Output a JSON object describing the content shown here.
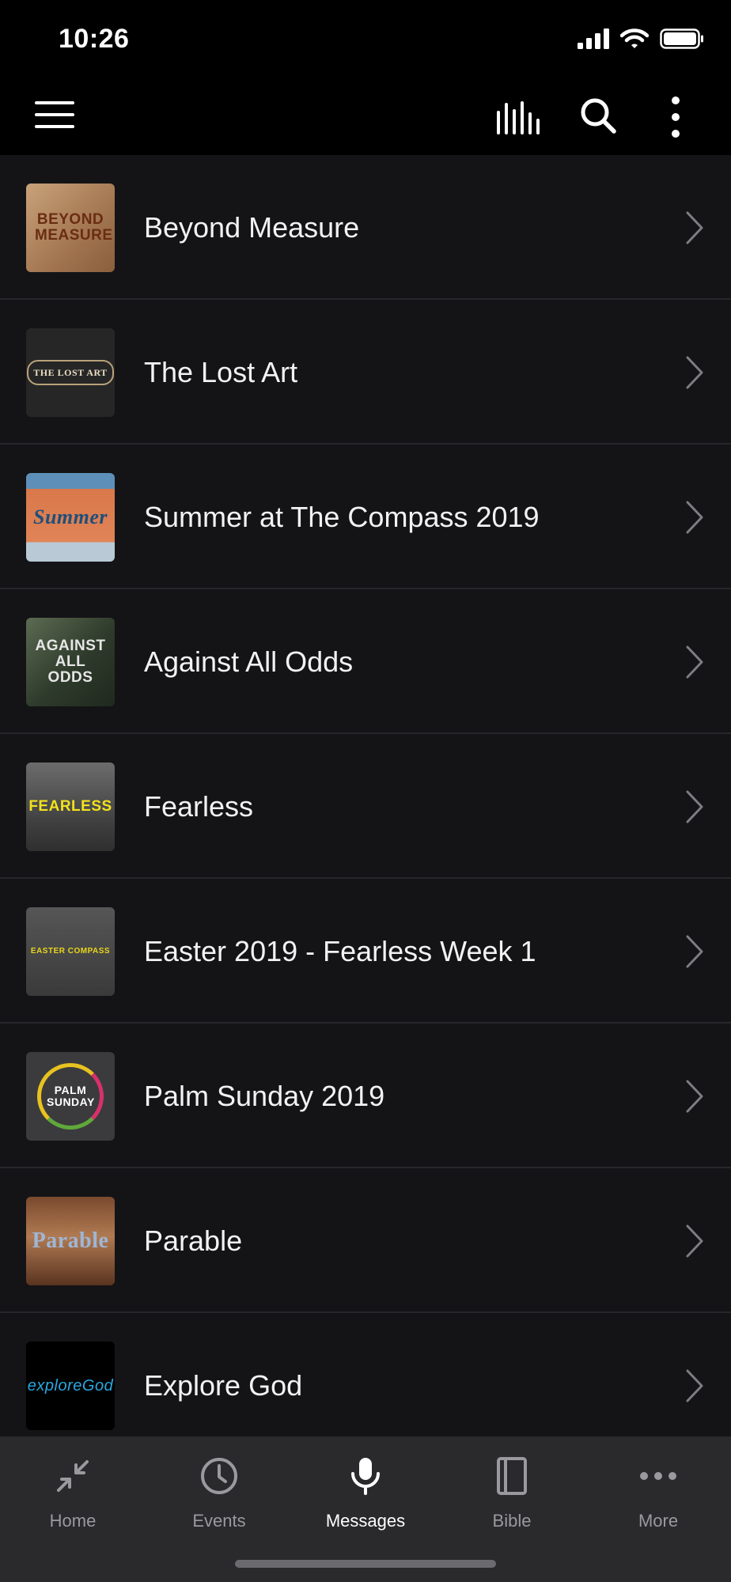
{
  "status_bar": {
    "time": "10:26"
  },
  "app_bar": {
    "menu_icon": "hamburger-menu-icon",
    "bars_icon": "audio-bars-icon",
    "search_icon": "search-icon",
    "more_icon": "vertical-dots-icon"
  },
  "messages": [
    {
      "title": "Beyond Measure",
      "thumb_text": "BEYOND MEASURE"
    },
    {
      "title": "The Lost Art",
      "thumb_text": "THE LOST ART"
    },
    {
      "title": "Summer at The Compass 2019",
      "thumb_text": "Summer"
    },
    {
      "title": "Against All Odds",
      "thumb_text": "AGAINST ALL ODDS"
    },
    {
      "title": "Fearless",
      "thumb_text": "FEARLESS"
    },
    {
      "title": "Easter 2019 - Fearless Week 1",
      "thumb_text": "EASTER COMPASS"
    },
    {
      "title": "Palm Sunday 2019",
      "thumb_text": "PALM SUNDAY"
    },
    {
      "title": "Parable",
      "thumb_text": "Parable"
    },
    {
      "title": "Explore God",
      "thumb_text": "exploreGod"
    }
  ],
  "tabs": [
    {
      "label": "Home",
      "icon": "home-icon",
      "active": false
    },
    {
      "label": "Events",
      "icon": "clock-icon",
      "active": false
    },
    {
      "label": "Messages",
      "icon": "microphone-icon",
      "active": true
    },
    {
      "label": "Bible",
      "icon": "book-icon",
      "active": false
    },
    {
      "label": "More",
      "icon": "horizontal-dots-icon",
      "active": false
    }
  ],
  "colors": {
    "background": "#000000",
    "list_background": "#141417",
    "divider": "#26272b",
    "tab_bar": "#2a2a2d",
    "inactive_tab": "#9a9a9e",
    "active_tab": "#ffffff"
  }
}
